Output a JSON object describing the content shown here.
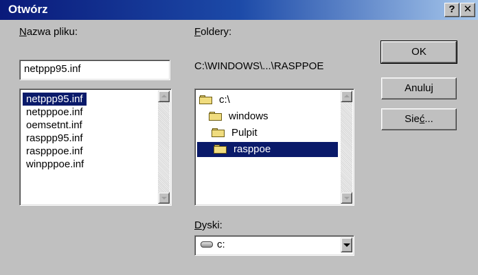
{
  "window": {
    "title": "Otwórz",
    "help_label": "?",
    "close_label": "✕"
  },
  "filename": {
    "label_u": "N",
    "label_rest": "azwa pliku:",
    "value": "netppp95.inf",
    "files": [
      {
        "name": "netppp95.inf",
        "selected": true
      },
      {
        "name": "netpppoe.inf",
        "selected": false
      },
      {
        "name": "oemsetnt.inf",
        "selected": false
      },
      {
        "name": "rasppp95.inf",
        "selected": false
      },
      {
        "name": "raspppoe.inf",
        "selected": false
      },
      {
        "name": "winpppoe.inf",
        "selected": false
      }
    ]
  },
  "folders": {
    "label_u": "F",
    "label_rest": "oldery:",
    "path": "C:\\WINDOWS\\...\\RASPPOE",
    "tree": [
      {
        "name": "c:\\",
        "icon": "open-folder-icon",
        "selected": false
      },
      {
        "name": "windows",
        "icon": "open-folder-icon",
        "selected": false
      },
      {
        "name": "Pulpit",
        "icon": "open-folder-icon",
        "selected": false
      },
      {
        "name": "rasppoe",
        "icon": "open-folder-icon",
        "selected": true
      }
    ]
  },
  "drives": {
    "label_u": "D",
    "label_rest": "yski:",
    "value": "c:",
    "icon": "hard-drive-icon"
  },
  "buttons": {
    "ok": "OK",
    "cancel": "Anuluj",
    "network_pre": "Sie",
    "network_u": "ć",
    "network_post": "..."
  }
}
